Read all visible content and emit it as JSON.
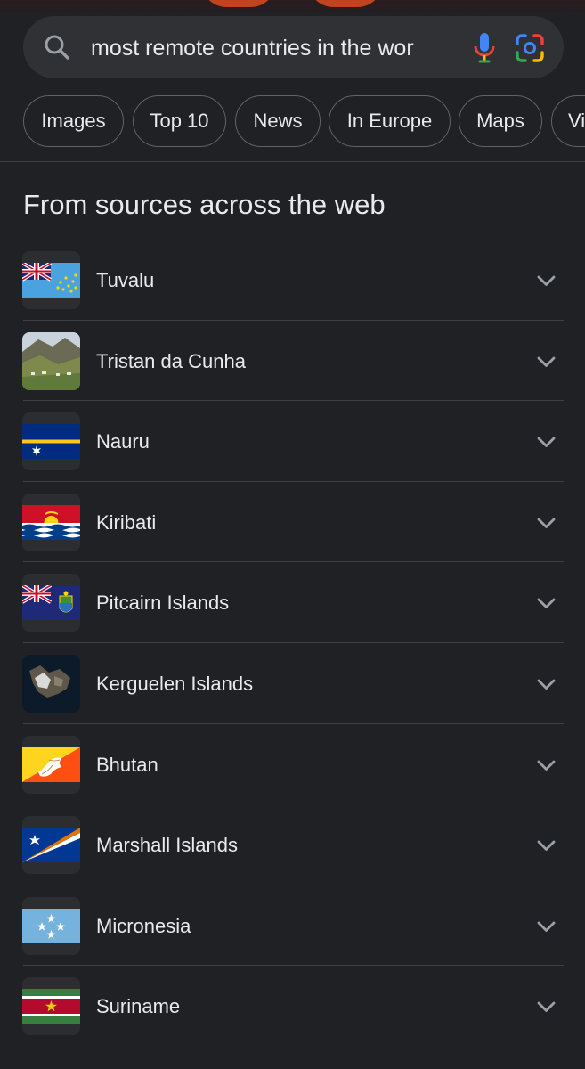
{
  "search": {
    "query": "most remote countries in the wor",
    "icons": {
      "search": "search-icon",
      "voice": "microphone-icon",
      "lens": "camera-lens-icon"
    }
  },
  "chips": [
    "Images",
    "Top 10",
    "News",
    "In Europe",
    "Maps",
    "Vi"
  ],
  "section": {
    "heading": "From sources across the web",
    "items": [
      {
        "label": "Tuvalu",
        "icon": "tuvalu-flag-icon"
      },
      {
        "label": "Tristan da Cunha",
        "icon": "tristan-da-cunha-photo"
      },
      {
        "label": "Nauru",
        "icon": "nauru-flag-icon"
      },
      {
        "label": "Kiribati",
        "icon": "kiribati-flag-icon"
      },
      {
        "label": "Pitcairn Islands",
        "icon": "pitcairn-flag-icon"
      },
      {
        "label": "Kerguelen Islands",
        "icon": "kerguelen-satellite-photo"
      },
      {
        "label": "Bhutan",
        "icon": "bhutan-flag-icon"
      },
      {
        "label": "Marshall Islands",
        "icon": "marshall-islands-flag-icon"
      },
      {
        "label": "Micronesia",
        "icon": "micronesia-flag-icon"
      },
      {
        "label": "Suriname",
        "icon": "suriname-flag-icon"
      }
    ]
  },
  "colors": {
    "background": "#202124",
    "search_bg": "#303134",
    "text": "#e8eaed",
    "divider": "#3c4043"
  }
}
